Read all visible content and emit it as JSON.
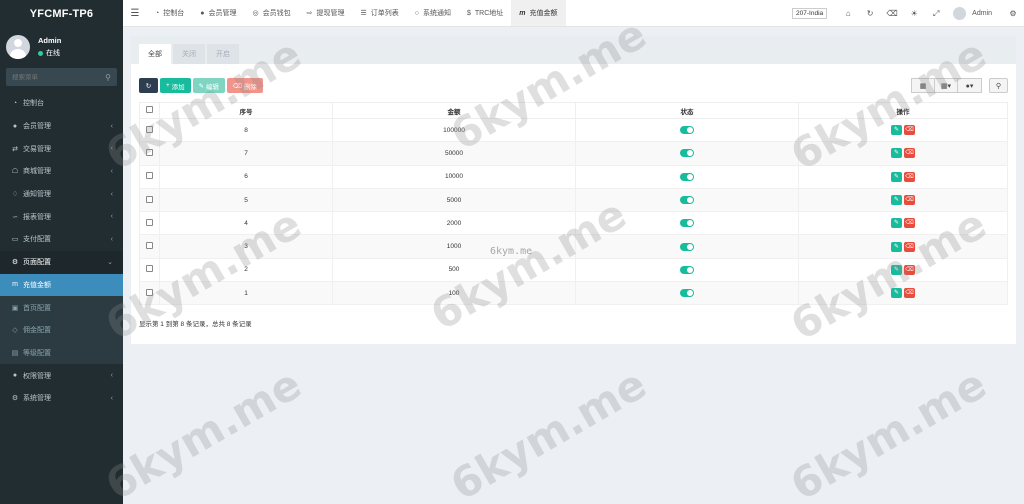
{
  "app": {
    "logo": "YFCMF-TP6"
  },
  "user": {
    "name": "Admin",
    "status": "在线"
  },
  "sidebar": {
    "search_placeholder": "搜索菜单",
    "items": [
      {
        "label": "控制台",
        "icon": "dashboard-icon",
        "chevron": false
      },
      {
        "label": "会员管理",
        "icon": "user-icon",
        "chevron": true
      },
      {
        "label": "交易管理",
        "icon": "exchange-icon",
        "chevron": true
      },
      {
        "label": "商城管理",
        "icon": "shop-icon",
        "chevron": true
      },
      {
        "label": "通知管理",
        "icon": "bell-icon",
        "chevron": true
      },
      {
        "label": "报表管理",
        "icon": "chart-icon",
        "chevron": true
      },
      {
        "label": "支付配置",
        "icon": "credit-card-icon",
        "chevron": true
      },
      {
        "label": "页面配置",
        "icon": "gear-icon",
        "chevron": true,
        "open": true
      },
      {
        "label": "充值金额",
        "icon": "recharge-icon",
        "active": true
      },
      {
        "label": "首页配置",
        "icon": "home-config-icon",
        "sub": true
      },
      {
        "label": "佣金配置",
        "icon": "diamond-icon",
        "sub": true
      },
      {
        "label": "等级配置",
        "icon": "level-icon",
        "sub": true
      },
      {
        "label": "权限管理",
        "icon": "group-icon",
        "chevron": true
      },
      {
        "label": "系统管理",
        "icon": "cogs-icon",
        "chevron": true
      }
    ]
  },
  "topnav": {
    "tabs": [
      {
        "label": "控制台",
        "icon": "dashboard-icon"
      },
      {
        "label": "会员管理",
        "icon": "user-icon"
      },
      {
        "label": "会员钱包",
        "icon": "wallet-icon"
      },
      {
        "label": "提现管理",
        "icon": "withdraw-icon"
      },
      {
        "label": "订单列表",
        "icon": "list-icon"
      },
      {
        "label": "系统通知",
        "icon": "comment-icon"
      },
      {
        "label": "TRC地址",
        "icon": "dollar-icon"
      },
      {
        "label": "充值金额",
        "icon": "recharge-icon",
        "active": true
      }
    ],
    "region": "207-India",
    "admin": "Admin"
  },
  "panel": {
    "tabs": [
      {
        "label": "全部",
        "active": true
      },
      {
        "label": "关闭",
        "active": false
      },
      {
        "label": "开启",
        "active": false
      }
    ]
  },
  "toolbar": {
    "add": "添加",
    "edit": "编辑",
    "delete": "删除"
  },
  "table": {
    "headers": {
      "id": "序号",
      "amount": "金额",
      "status": "状态",
      "ops": "操作"
    },
    "rows": [
      {
        "id": "8",
        "amount": "100000"
      },
      {
        "id": "7",
        "amount": "50000"
      },
      {
        "id": "6",
        "amount": "10000"
      },
      {
        "id": "5",
        "amount": "5000"
      },
      {
        "id": "4",
        "amount": "2000"
      },
      {
        "id": "3",
        "amount": "1000"
      },
      {
        "id": "2",
        "amount": "500"
      },
      {
        "id": "1",
        "amount": "100"
      }
    ]
  },
  "pager": {
    "text": "显示第 1 到第 8 条记录，总共 8 条记录"
  },
  "watermark": {
    "text": "6kym.me",
    "small": "6kym.me"
  },
  "colors": {
    "sidebar": "#222d32",
    "active": "#3c8dbc",
    "green": "#18bc9c",
    "red": "#e74c3c"
  }
}
